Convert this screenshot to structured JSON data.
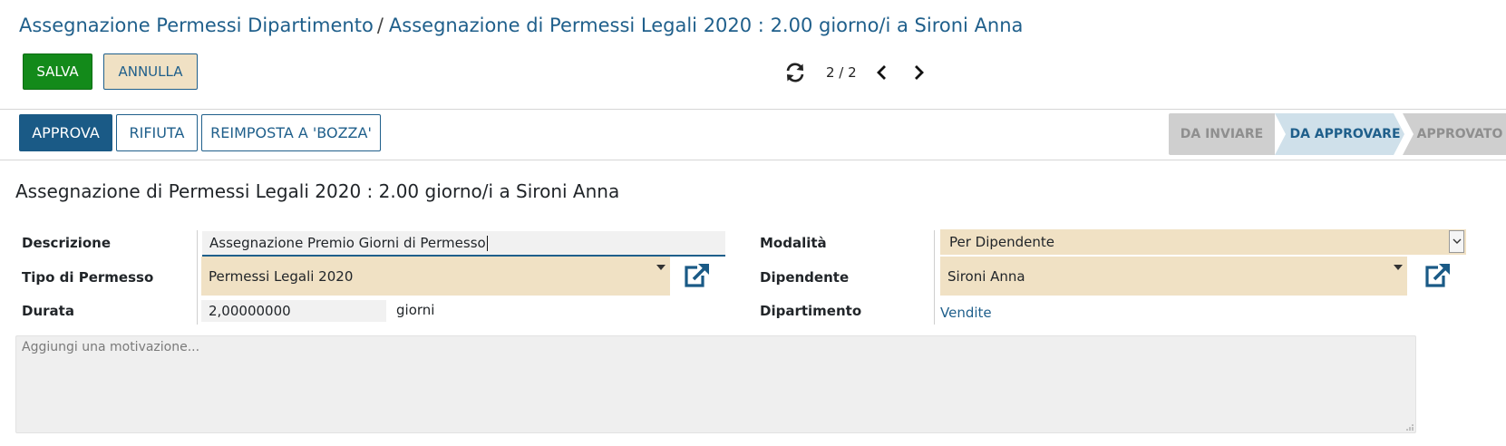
{
  "breadcrumb": {
    "parent": "Assegnazione Permessi Dipartimento",
    "separator": "/",
    "current": "Assegnazione di Permessi Legali 2020 : 2.00 giorno/i a Sironi Anna"
  },
  "toolbar": {
    "save_label": "SALVA",
    "cancel_label": "ANNULLA"
  },
  "pager": {
    "value": "2 / 2"
  },
  "actions": {
    "approve": "APPROVA",
    "refuse": "RIFIUTA",
    "reset": "REIMPOSTA A 'BOZZA'"
  },
  "statusbar": {
    "steps": [
      {
        "label": "DA INVIARE",
        "active": false
      },
      {
        "label": "DA APPROVARE",
        "active": true
      },
      {
        "label": "APPROVATO",
        "active": false
      }
    ]
  },
  "record": {
    "title": "Assegnazione di Permessi Legali 2020 : 2.00 giorno/i a Sironi Anna",
    "fields": {
      "descrizione": {
        "label": "Descrizione",
        "value": "Assegnazione Premio Giorni di Permesso"
      },
      "tipo": {
        "label": "Tipo di Permesso",
        "value": "Permessi Legali 2020"
      },
      "durata": {
        "label": "Durata",
        "value": "2,00000000",
        "unit": "giorni"
      },
      "modalita": {
        "label": "Modalità",
        "value": "Per Dipendente"
      },
      "dipendente": {
        "label": "Dipendente",
        "value": "Sironi Anna"
      },
      "dipartimento": {
        "label": "Dipartimento",
        "value": "Vendite"
      }
    },
    "notes_placeholder": "Aggiungi una  motivazione..."
  },
  "colors": {
    "primary": "#1a5a86",
    "link": "#1f5f8b",
    "save": "#138a1a",
    "required_bg": "#f0e1c4",
    "active_step_bg": "#cfe0ea",
    "inactive_step_bg": "#cfcfcf"
  },
  "icons": [
    "reload-icon",
    "chevron-left-icon",
    "chevron-right-icon",
    "external-link-icon",
    "dropdown-caret-icon",
    "resize-handle-icon"
  ]
}
